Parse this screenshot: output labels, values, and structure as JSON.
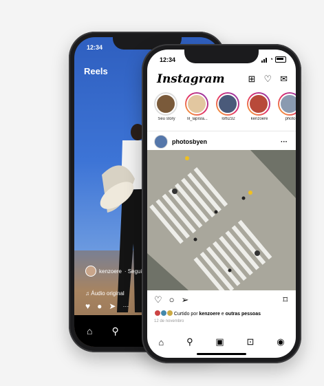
{
  "reels_phone": {
    "time": "12:34",
    "title": "Reels",
    "username": "kenzoere",
    "follow": "· Seguir",
    "audio": "Áudio original",
    "more": "···"
  },
  "feed_phone": {
    "time": "12:34",
    "logo": "Instagram",
    "stories": [
      {
        "label": "Seu story"
      },
      {
        "label": "lil_lapísla..."
      },
      {
        "label": "lofti232"
      },
      {
        "label": "kenzoere"
      },
      {
        "label": "photo"
      }
    ],
    "post": {
      "username": "photosbyen",
      "more": "···",
      "liked_prefix": "Curtido por ",
      "liked_user": "kenzoere",
      "liked_mid": " e ",
      "liked_rest": "outras pessoas",
      "date": "12 de novembro"
    }
  },
  "colors": {
    "accent": "#e1306c",
    "link": "#0095f6"
  }
}
